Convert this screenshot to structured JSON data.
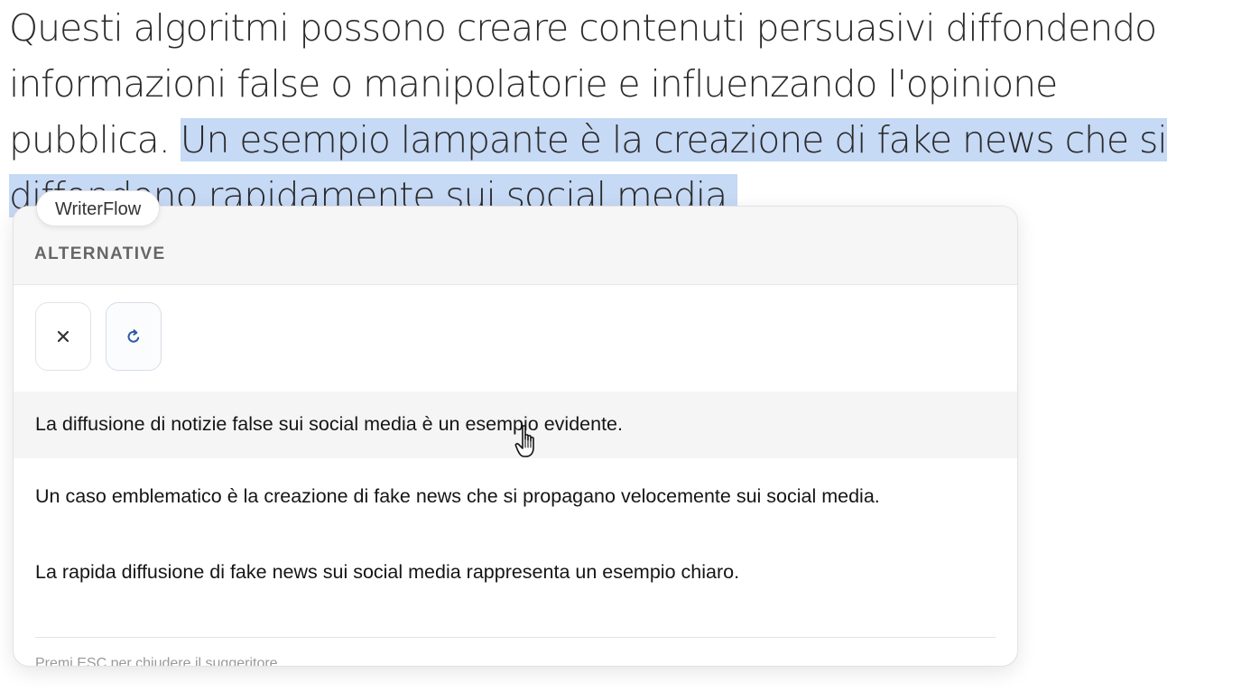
{
  "document": {
    "line1": "Questi algoritmi possono creare contenuti persuasivi diffondendo",
    "line2": "informazioni false o manipolatorie e influenzando l'opinione",
    "line3_plain": "pubblica. ",
    "line3_selected": "Un esempio lampante è la creazione di fake news che si",
    "line4_selected": "diffondono rapidamente sui social media."
  },
  "selection_color": "#c6d9f5",
  "badge": {
    "label": "WriterFlow"
  },
  "popup": {
    "header_title": "ALTERNATIVE",
    "close_icon": "close-icon",
    "retry_icon": "refresh-icon",
    "suggestions": [
      "La diffusione di notizie false sui social media è un esempio evidente.",
      "Un caso emblematico è la creazione di fake news che si propagano velocemente sui social media.",
      "La rapida diffusione di fake news sui social media rappresenta un esempio chiaro."
    ],
    "footer_hint": "Premi ESC per chiudere il suggeritore"
  }
}
